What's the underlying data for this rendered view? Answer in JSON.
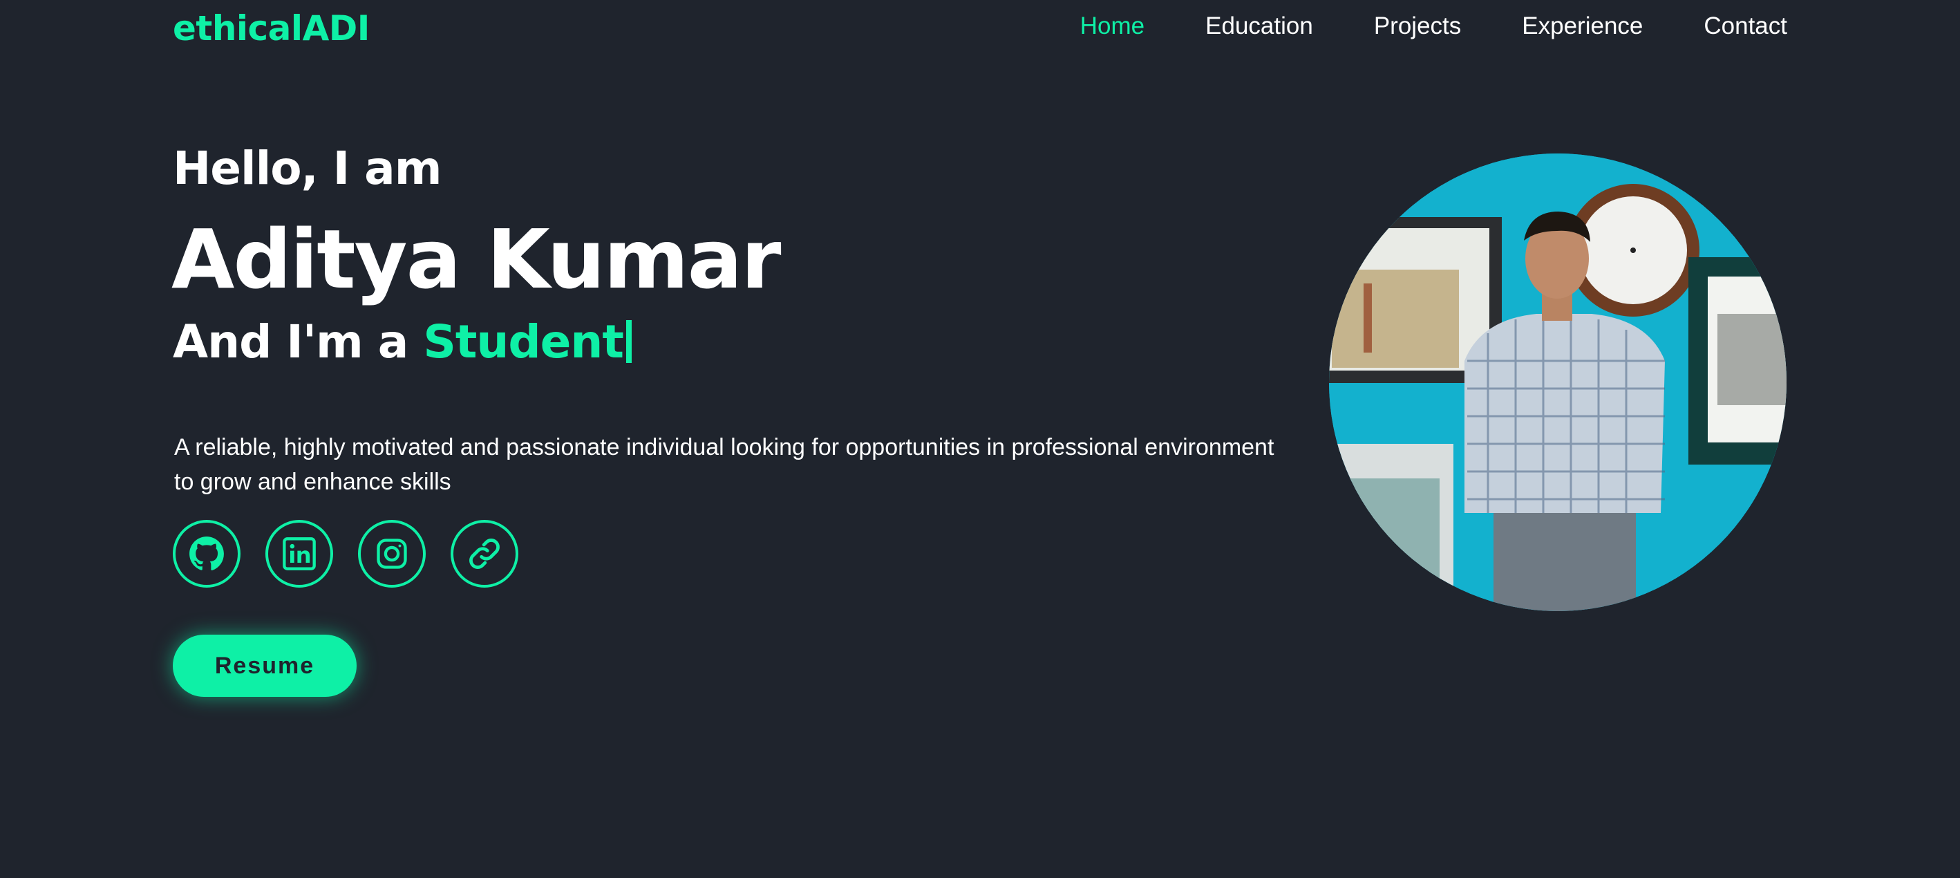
{
  "header": {
    "logo": "ethicalADI",
    "nav": [
      {
        "label": "Home",
        "active": true
      },
      {
        "label": "Education",
        "active": false
      },
      {
        "label": "Projects",
        "active": false
      },
      {
        "label": "Experience",
        "active": false
      },
      {
        "label": "Contact",
        "active": false
      }
    ]
  },
  "hero": {
    "greeting": "Hello, I am",
    "name": "Aditya Kumar",
    "role_prefix": "And I'm a ",
    "role_highlight": "Student",
    "description": "A reliable, highly motivated and passionate individual looking for opportunities in professional environment to grow and enhance skills",
    "resume_label": "Resume"
  },
  "socials": [
    {
      "icon": "github-icon"
    },
    {
      "icon": "linkedin-icon"
    },
    {
      "icon": "instagram-icon"
    },
    {
      "icon": "link-icon"
    }
  ],
  "colors": {
    "background": "#1f242d",
    "accent": "#0ef0a6",
    "text": "#ffffff"
  }
}
